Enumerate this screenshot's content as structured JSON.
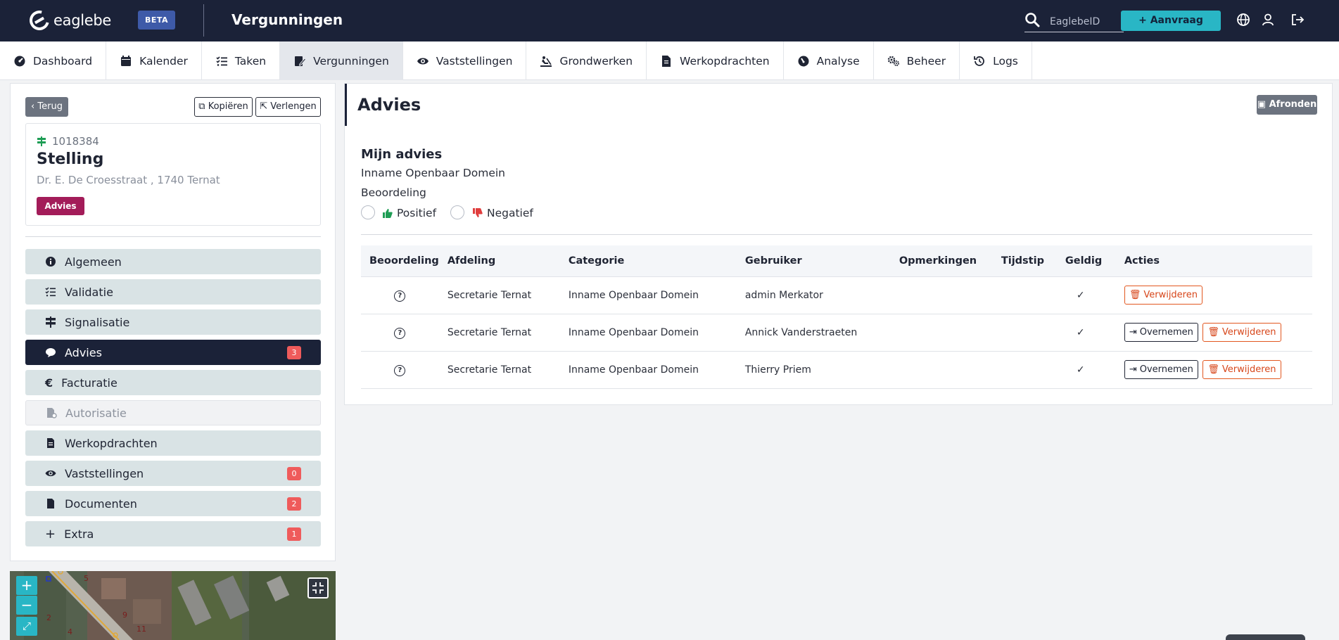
{
  "header": {
    "logo_text": "eaglebe",
    "beta_label": "BETA",
    "title": "Vergunningen",
    "search_placeholder": "EaglebeID",
    "aanvraag_label": "Aanvraag"
  },
  "nav": {
    "items": [
      {
        "label": "Dashboard",
        "icon": "dashboard-icon"
      },
      {
        "label": "Kalender",
        "icon": "calendar-icon"
      },
      {
        "label": "Taken",
        "icon": "tasks-icon"
      },
      {
        "label": "Vergunningen",
        "icon": "permit-icon",
        "active": true
      },
      {
        "label": "Vaststellingen",
        "icon": "eye-icon"
      },
      {
        "label": "Grondwerken",
        "icon": "digging-icon"
      },
      {
        "label": "Werkopdrachten",
        "icon": "document-icon"
      },
      {
        "label": "Analyse",
        "icon": "gauge-icon"
      },
      {
        "label": "Beheer",
        "icon": "gears-icon"
      },
      {
        "label": "Logs",
        "icon": "history-icon"
      }
    ]
  },
  "sidebar": {
    "back_label": "Terug",
    "copy_label": "Kopiëren",
    "extend_label": "Verlengen",
    "card": {
      "id": "1018384",
      "title": "Stelling",
      "address": "Dr. E. De Croesstraat , 1740 Ternat",
      "badge": "Advies"
    },
    "menu": [
      {
        "label": "Algemeen",
        "icon": "info-icon"
      },
      {
        "label": "Validatie",
        "icon": "list-check-icon"
      },
      {
        "label": "Signalisatie",
        "icon": "signpost-icon"
      },
      {
        "label": "Advies",
        "icon": "comment-icon",
        "badge": "3",
        "active": true
      },
      {
        "label": "Facturatie",
        "icon": "euro-icon"
      },
      {
        "label": "Autorisatie",
        "icon": "file-signature-icon",
        "disabled": true
      },
      {
        "label": "Werkopdrachten",
        "icon": "document-icon"
      },
      {
        "label": "Vaststellingen",
        "icon": "eye-icon",
        "badge": "0"
      },
      {
        "label": "Documenten",
        "icon": "file-icon",
        "badge": "2"
      },
      {
        "label": "Extra",
        "icon": "plus-icon",
        "badge": "1"
      }
    ]
  },
  "map": {
    "zoom_in": "+",
    "zoom_out": "−",
    "labels": [
      "5",
      "9",
      "2",
      "4",
      "11"
    ]
  },
  "advies": {
    "title": "Advies",
    "afronden_label": "Afronden",
    "mijn_advies_title": "Mijn advies",
    "mijn_advies_sub": "Inname Openbaar Domein",
    "beoordeling_label": "Beoordeling",
    "positief_label": "Positief",
    "negatief_label": "Negatief",
    "columns": [
      "Beoordeling",
      "Afdeling",
      "Categorie",
      "Gebruiker",
      "Opmerkingen",
      "Tijdstip",
      "Geldig",
      "Acties"
    ],
    "rows": [
      {
        "afdeling": "Secretarie Ternat",
        "categorie": "Inname Openbaar Domein",
        "gebruiker": "admin Merkator",
        "opmerkingen": "",
        "tijdstip": "",
        "actions": [
          "Verwijderen"
        ]
      },
      {
        "afdeling": "Secretarie Ternat",
        "categorie": "Inname Openbaar Domein",
        "gebruiker": "Annick Vanderstraeten",
        "opmerkingen": "",
        "tijdstip": "",
        "actions": [
          "Overnemen",
          "Verwijderen"
        ]
      },
      {
        "afdeling": "Secretarie Ternat",
        "categorie": "Inname Openbaar Domein",
        "gebruiker": "Thierry Priem",
        "opmerkingen": "",
        "tijdstip": "",
        "actions": [
          "Overnemen",
          "Verwijderen"
        ]
      }
    ],
    "overnemen_label": "Overnemen",
    "verwijderen_label": "Verwijderen"
  },
  "colors": {
    "header_bg": "#1b2238",
    "accent": "#29b6c5",
    "badge_advies": "#a31c59",
    "count_badge": "#ef5b5b",
    "delete": "#e2571f",
    "positive": "#1f9d55",
    "negative": "#e03e3e"
  }
}
